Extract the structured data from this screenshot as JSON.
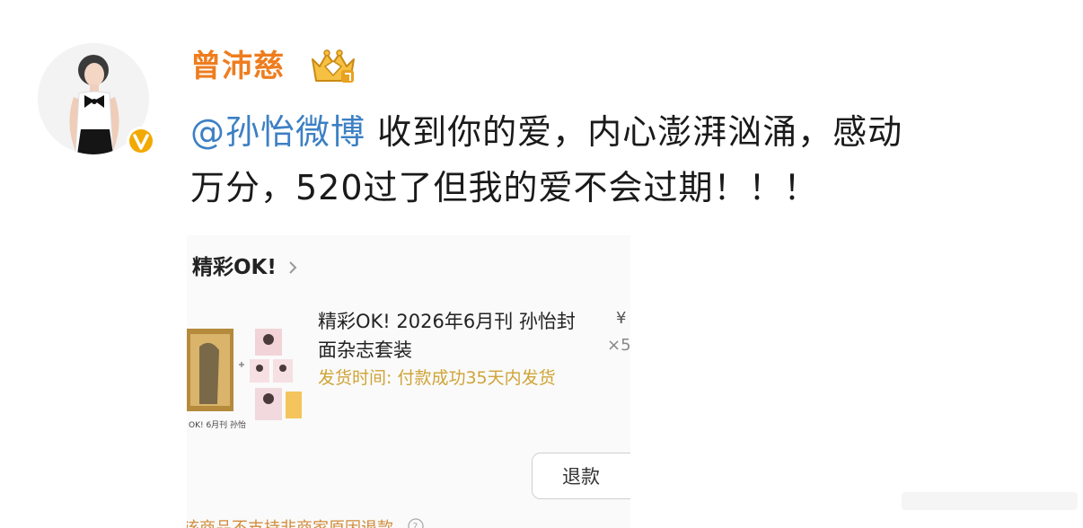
{
  "post": {
    "author": "曾沛慈",
    "mention": "@孙怡微博",
    "text_line1": " 收到你的爱，内心澎湃汹涌，感动",
    "text_line2": "万分，520过了但我的爱不会过期！！！"
  },
  "order_card": {
    "shop_name": "精彩OK!",
    "product_title": "精彩OK! 2026年6月刊 孙怡封面杂志套装",
    "ship_time": "发货时间: 付款成功35天内发货",
    "price_symbol": "¥",
    "quantity": "×5",
    "refund_label": "退款",
    "notice": "该商品不支持非商家原因退款"
  },
  "colors": {
    "username": "#ee7d1f",
    "mention": "#3d80c4",
    "verified_badge": "#f2a900",
    "ship_time": "#cfa437"
  },
  "icons": [
    "verified-v-icon",
    "crown-level-badge-icon",
    "chevron-right-icon",
    "question-circle-icon"
  ]
}
